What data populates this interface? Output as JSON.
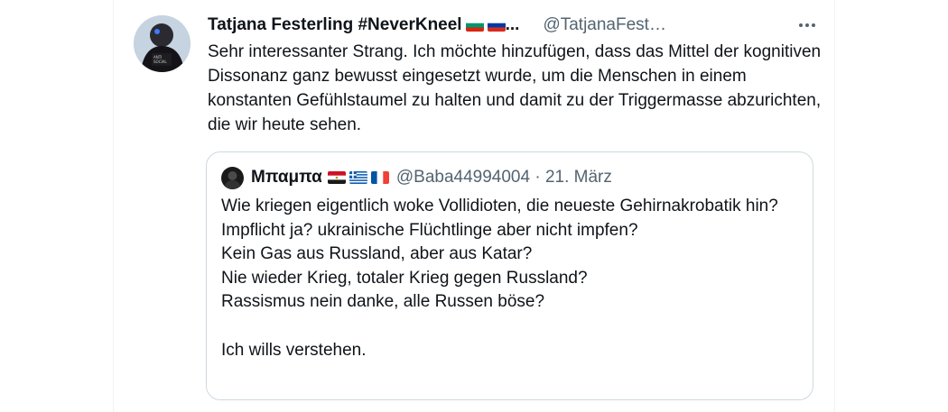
{
  "tweet": {
    "display_name": "Tatjana Festerling #NeverKneel",
    "name_flags": [
      "flag-bulgaria",
      "flag-russia"
    ],
    "name_truncation": "...",
    "handle": "@TatjanaFest…",
    "more_icon": "more-horizontal-icon",
    "text": "Sehr interessanter Strang. Ich möchte hinzufügen, dass das Mittel der kognitiven Dissonanz ganz bewusst eingesetzt wurde, um die Menschen in einem konstanten Gefühlstaumel zu halten und damit zu der Triggermasse abzurichten, die wir heute sehen."
  },
  "quoted_tweet": {
    "display_name": "Μπαμπα",
    "name_flags": [
      "flag-egypt",
      "flag-greece",
      "flag-france"
    ],
    "handle_and_date": "@Baba44994004 · 21. März",
    "text": "Wie kriegen eigentlich woke Vollidioten, die neueste Gehirnakrobatik hin?\nImpflicht ja? ukrainische Flüchtlinge aber nicht impfen?\nKein Gas aus Russland, aber aus Katar?\nNie wieder Krieg, totaler Krieg gegen Russland?\nRassismus nein danke, alle Russen böse?\n\nIch wills verstehen."
  },
  "colors": {
    "text_primary": "#0f1419",
    "text_secondary": "#536471",
    "border": "#cfd9de"
  }
}
